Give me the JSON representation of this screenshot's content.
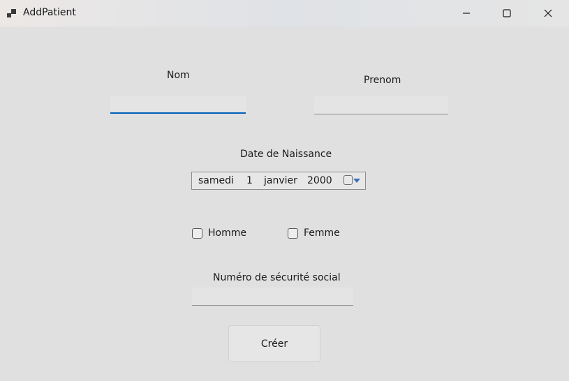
{
  "window": {
    "title": "AddPatient",
    "icon": "app-form-icon",
    "controls": [
      "minimize-icon",
      "maximize-icon",
      "close-icon"
    ]
  },
  "form": {
    "nom": {
      "label": "Nom",
      "value": "",
      "focused": true
    },
    "prenom": {
      "label": "Prenom",
      "value": ""
    },
    "date_naissance": {
      "label": "Date de Naissance",
      "day_name": "samedi",
      "day": "1",
      "month": "janvier",
      "year": "2000"
    },
    "sexe": {
      "homme": {
        "label": "Homme",
        "checked": false
      },
      "femme": {
        "label": "Femme",
        "checked": false
      }
    },
    "numero_secu": {
      "label": "Numéro de sécurité social",
      "value": ""
    },
    "submit_label": "Créer"
  },
  "colors": {
    "background": "#e0e0e0",
    "focus_accent": "#005fb8"
  }
}
